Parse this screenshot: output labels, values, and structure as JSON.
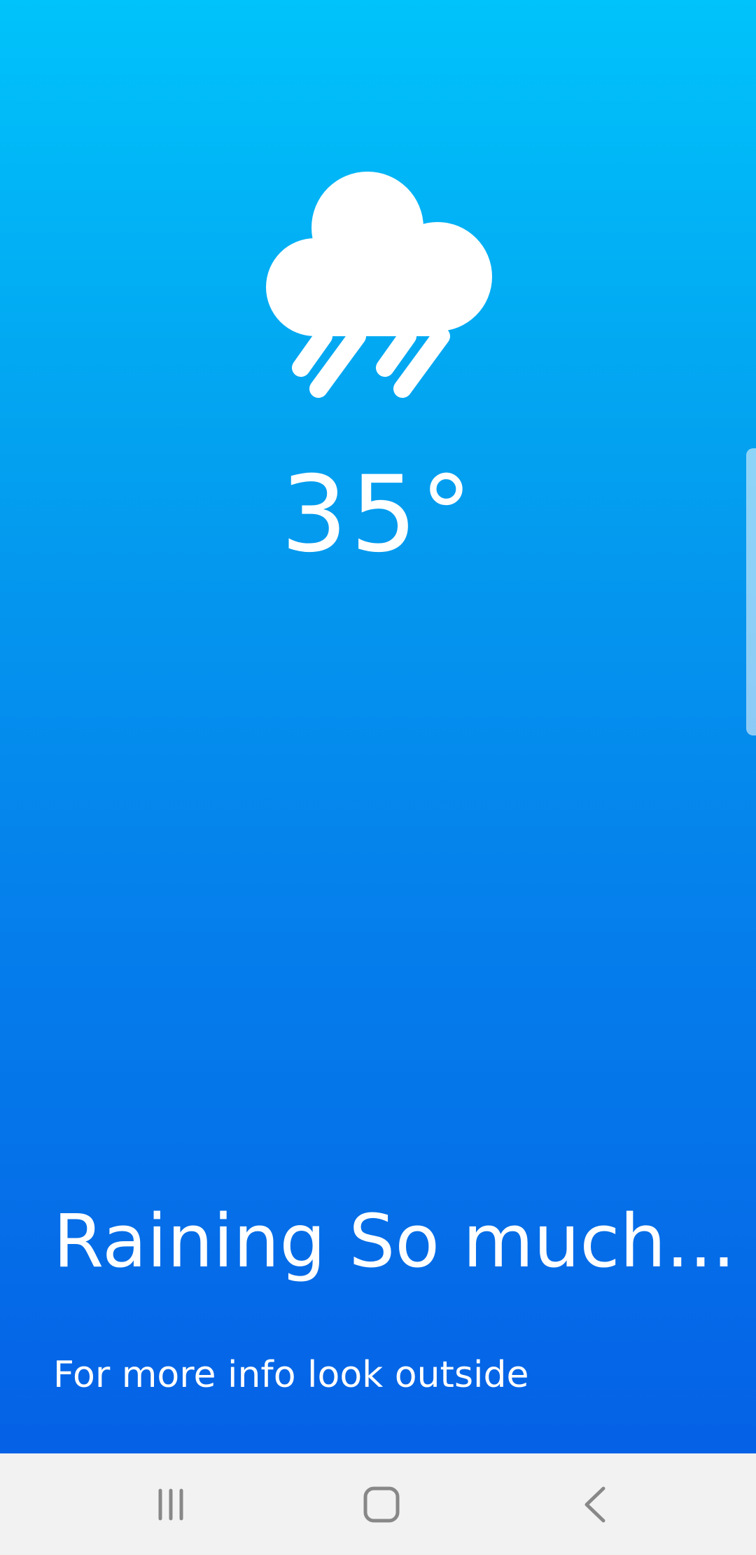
{
  "weather": {
    "icon": "rain-cloud-icon",
    "temperature": "35°",
    "headline": "Raining So much...",
    "subline": "For more info look outside"
  },
  "colors": {
    "gradient_top": "#00c3fb",
    "gradient_bottom": "#0561e6",
    "text": "#ffffff",
    "nav_bar": "#f2f2f2",
    "nav_icon": "#888888"
  },
  "nav_bar": {
    "buttons": [
      {
        "icon": "recents-icon"
      },
      {
        "icon": "home-icon"
      },
      {
        "icon": "back-icon"
      }
    ]
  }
}
